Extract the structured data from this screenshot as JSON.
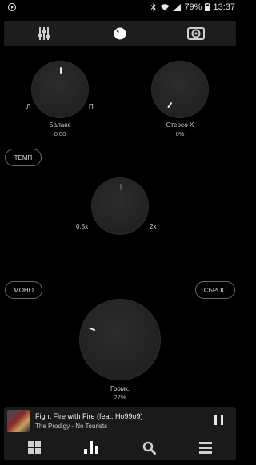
{
  "status": {
    "battery": "79%",
    "time": "13:37"
  },
  "toolbar": {
    "items": [
      {
        "icon": "sliders-icon"
      },
      {
        "icon": "knob-icon"
      },
      {
        "icon": "speaker-icon"
      }
    ]
  },
  "balance": {
    "label": "Баланс",
    "value": "0.00",
    "left": "Л",
    "right": "П"
  },
  "stereo": {
    "label": "Стерео X",
    "value": "0%"
  },
  "tempo": {
    "button": "ТЕМП",
    "min": "0.5x",
    "max": "2x"
  },
  "mono": {
    "button": "МОНО"
  },
  "reset": {
    "button": "СБРОС"
  },
  "volume": {
    "label": "Громк.",
    "value": "27%"
  },
  "player": {
    "title": "Fight Fire with Fire (feat. Ho99o9)",
    "artist": "The Prodigy - No Tourists"
  },
  "nav": {
    "items": [
      {
        "icon": "grid-icon"
      },
      {
        "icon": "bars-icon"
      },
      {
        "icon": "search-icon"
      },
      {
        "icon": "menu-icon"
      }
    ]
  }
}
